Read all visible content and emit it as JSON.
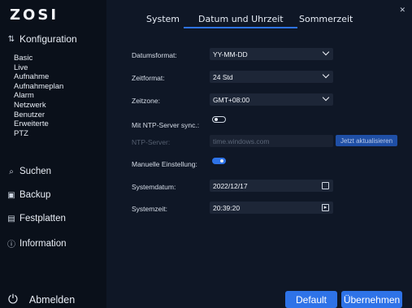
{
  "app": {
    "logo": "ZOSI"
  },
  "sidebar": {
    "config_label": "Konfiguration",
    "sub_items": [
      "Basic",
      "Live",
      "Aufnahme",
      "Aufnahmeplan",
      "Alarm",
      "Netzwerk",
      "Benutzer",
      "Erweiterte",
      "PTZ"
    ],
    "search_label": "Suchen",
    "backup_label": "Backup",
    "disks_label": "Festplatten",
    "info_label": "Information",
    "logout_label": "Abmelden"
  },
  "tabs": [
    "System",
    "Datum und Uhrzeit",
    "Sommerzeit"
  ],
  "active_tab": "Datum und Uhrzeit",
  "form": {
    "date_format": {
      "label": "Datumsformat:",
      "value": "YY-MM-DD"
    },
    "time_format": {
      "label": "Zeitformat:",
      "value": "24 Std"
    },
    "time_zone": {
      "label": "Zeitzone:",
      "value": "GMT+08:00"
    },
    "ntp_sync": {
      "label": "Mit NTP-Server sync.:",
      "enabled": false
    },
    "ntp_server": {
      "label": "NTP-Server:",
      "value": "time.windows.com",
      "button": "Jetzt aktualisieren"
    },
    "manual": {
      "label": "Manuelle Einstellung:",
      "enabled": true
    },
    "system_date": {
      "label": "Systemdatum:",
      "value": "2022/12/17"
    },
    "system_time": {
      "label": "Systemzeit:",
      "value": "20:39:20"
    }
  },
  "buttons": {
    "default": "Default",
    "apply": "Übernehmen"
  },
  "colors": {
    "accent": "#2e73e8",
    "background": "#0f1726",
    "sidebar": "#0a101a"
  }
}
